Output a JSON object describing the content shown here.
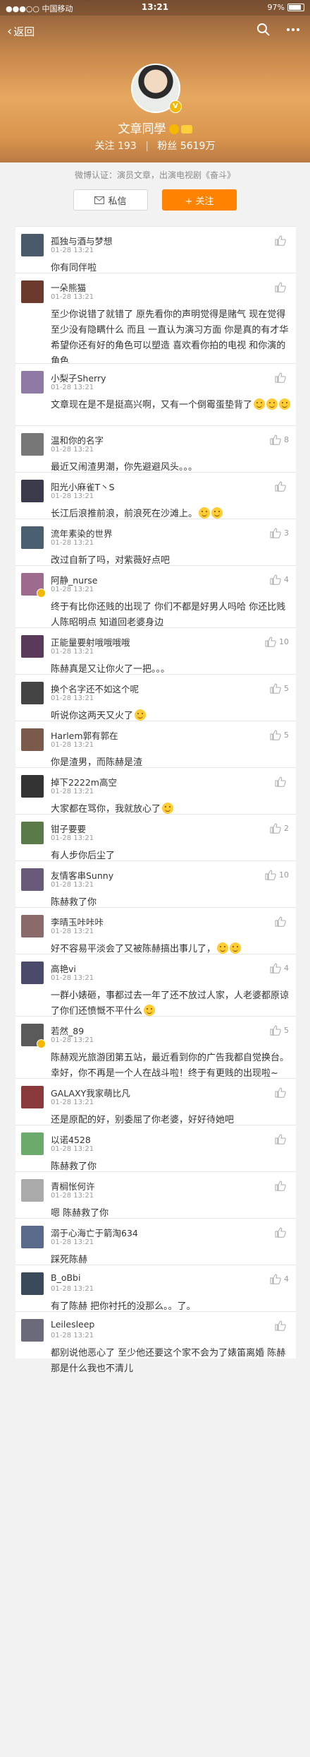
{
  "status_bar": {
    "carrier": "●●●○○ 中国移动",
    "wifi_icon": "wifi-icon",
    "time": "13:21",
    "battery": "97%"
  },
  "nav": {
    "back_label": "返回"
  },
  "profile": {
    "name": "文章同學",
    "follow_label": "关注",
    "follow_count": "193",
    "fans_label": "粉丝",
    "fans_count": "5619万",
    "verification": "微博认证：演员文章，出演电视剧《奋斗》",
    "message_button": "私信",
    "follow_button": "+ 关注"
  },
  "comments": [
    {
      "name": "孤独与酒与梦想",
      "time": "01-28 13:21",
      "text": "你有同伴啦",
      "likes": "",
      "avatar": "#4a5a6a"
    },
    {
      "name": "一朵熊猫",
      "time": "01-28 13:21",
      "text": "至少你说错了就错了 原先看你的声明觉得是赌气 现在觉得至少没有隐瞒什么   而且 一直认为演习方面 你是真的有才华 希望你还有好的角色可以塑造  喜欢看你拍的电视 和你演的角色",
      "likes": "",
      "avatar": "#6b3a2c"
    },
    {
      "name": "小梨子Sherry",
      "time": "01-28 13:21",
      "text": "文章现在是不是挺高兴啊，又有一个倒霉蛋垫背了",
      "likes": "",
      "avatar": "#8e7aa4",
      "emojis": 3
    },
    {
      "name": "温和你的名字",
      "time": "01-28 13:21",
      "text": "最近又闹渣男潮，你先避避风头。。。",
      "likes": "8",
      "avatar": "#777"
    },
    {
      "name": "阳光小麻雀T丶S",
      "time": "01-28 13:21",
      "text": "长江后浪推前浪，前浪死在沙滩上。",
      "likes": "",
      "avatar": "#3a3a4a",
      "emojis": 2
    },
    {
      "name": "流年素染的世界",
      "time": "01-28 13:21",
      "text": "改过自新了吗，对紫薇好点吧",
      "likes": "3",
      "avatar": "#4a6070"
    },
    {
      "name": "阿静_nurse",
      "time": "01-28 13:21",
      "text": "终于有比你还贱的出现了 你们不都是好男人吗哈 你还比贱人陈昭明点 知道回老婆身边",
      "likes": "4",
      "avatar": "#9c6b8e",
      "vip": true
    },
    {
      "name": "正能量要射哦哦哦哦",
      "time": "01-28 13:21",
      "text": "陈赫真是又让你火了一把。。。",
      "likes": "10",
      "avatar": "#5a3a5a"
    },
    {
      "name": "换个名字还不如这个呢",
      "time": "01-28 13:21",
      "text": "听说你这两天又火了",
      "likes": "5",
      "avatar": "#444",
      "emojis": 1
    },
    {
      "name": "Harlem郭有郭在",
      "time": "01-28 13:21",
      "text": "你是渣男，而陈赫是渣",
      "likes": "5",
      "avatar": "#7a5a4a"
    },
    {
      "name": "掉下2222m高空",
      "time": "01-28 13:21",
      "text": "大家都在骂你，我就放心了",
      "likes": "",
      "avatar": "#333",
      "emojis": 1
    },
    {
      "name": "钳子要要",
      "time": "01-28 13:21",
      "text": "有人步你后尘了",
      "likes": "2",
      "avatar": "#5a7a4a"
    },
    {
      "name": "友情客串Sunny",
      "time": "01-28 13:21",
      "text": "陈赫救了你",
      "likes": "10",
      "avatar": "#6a5a7a"
    },
    {
      "name": "李晴玉咔咔咔",
      "time": "01-28 13:21",
      "text": "好不容易平淡会了又被陈赫搞出事儿了，",
      "likes": "",
      "avatar": "#8a6a6a",
      "emojis": 2
    },
    {
      "name": "高艳vi",
      "time": "01-28 13:21",
      "text": "一群小婊砸，事都过去一年了还不放过人家，人老婆都原谅了你们还愤慨不平什么",
      "likes": "4",
      "avatar": "#4a4a6a",
      "emojis": 1
    },
    {
      "name": "若然_89",
      "time": "01-28 13:21",
      "text": "陈赫观光旅游团第五站，最近看到你的广告我都自觉换台。幸好，你不再是一个人在战斗啦！终于有更贱的出现啦~",
      "likes": "5",
      "avatar": "#5a5a5a",
      "vip": true
    },
    {
      "name": "GALAXY我家萌比凡",
      "time": "01-28 13:21",
      "text": "还是原配的好，别委屈了你老婆，好好待她吧",
      "likes": "",
      "avatar": "#8a3a3a"
    },
    {
      "name": "以诺4528",
      "time": "01-28 13:21",
      "text": "陈赫救了你",
      "likes": "",
      "avatar": "#6aaa6a"
    },
    {
      "name": "青榈怅何许",
      "time": "01-28 13:21",
      "text": "嗯 陈赫救了你",
      "likes": "",
      "avatar": "#aaa"
    },
    {
      "name": "溺于心海亡于箭淘634",
      "time": "01-28 13:21",
      "text": "踩死陈赫",
      "likes": "",
      "avatar": "#5a6a8a"
    },
    {
      "name": "B_oBbi",
      "time": "01-28 13:21",
      "text": "有了陈赫 把你衬托的没那么。。了。",
      "likes": "4",
      "avatar": "#3a4a5a"
    },
    {
      "name": "Leilesleep",
      "time": "01-28 13:21",
      "text": "都别说他恶心了 至少他还要这个家不会为了婊笛离婚 陈赫那是什么我也不清儿",
      "likes": "",
      "avatar": "#6a6a7a"
    }
  ]
}
